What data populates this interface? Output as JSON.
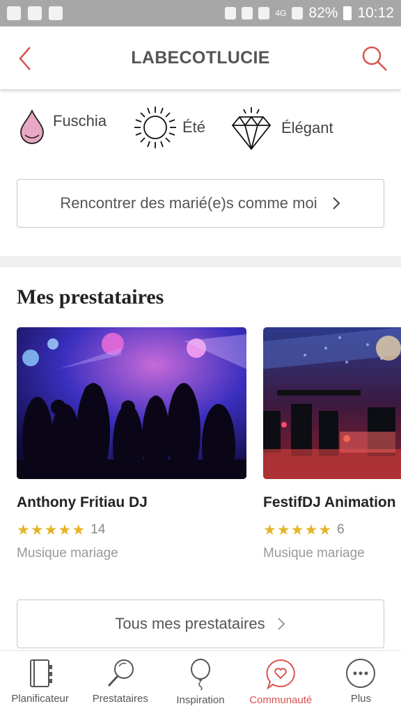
{
  "status_bar": {
    "network": "4G",
    "battery": "82%",
    "time": "10:12"
  },
  "header": {
    "title": "LABECOTLUCIE",
    "back_icon": "chevron-left-icon",
    "search_icon": "search-icon"
  },
  "styles": [
    {
      "label": "Fuschia",
      "icon": "drop-icon",
      "color": "#e8a7c3"
    },
    {
      "label": "Été",
      "icon": "sun-icon"
    },
    {
      "label": "Élégant",
      "icon": "diamond-icon"
    }
  ],
  "meet_button": {
    "label": "Rencontrer des marié(e)s comme moi"
  },
  "section": {
    "title": "Mes prestataires"
  },
  "vendors": [
    {
      "name": "Anthony Fritiau DJ",
      "rating": 5,
      "review_count": "14",
      "category": "Musique mariage"
    },
    {
      "name": "FestifDJ Animation",
      "rating": 5,
      "review_count": "6",
      "category": "Musique mariage"
    }
  ],
  "all_vendors_button": {
    "label": "Tous mes prestataires"
  },
  "bottom_nav": [
    {
      "label": "Planificateur",
      "icon": "notebook-icon",
      "active": false
    },
    {
      "label": "Prestataires",
      "icon": "magnifier-icon",
      "active": false
    },
    {
      "label": "Inspiration",
      "icon": "balloon-icon",
      "active": false
    },
    {
      "label": "Communauté",
      "icon": "chat-heart-icon",
      "active": true
    },
    {
      "label": "Plus",
      "icon": "more-icon",
      "active": false
    }
  ],
  "colors": {
    "accent": "#d9534f",
    "star": "#e6b428",
    "status_bar": "#a7a7a7"
  }
}
